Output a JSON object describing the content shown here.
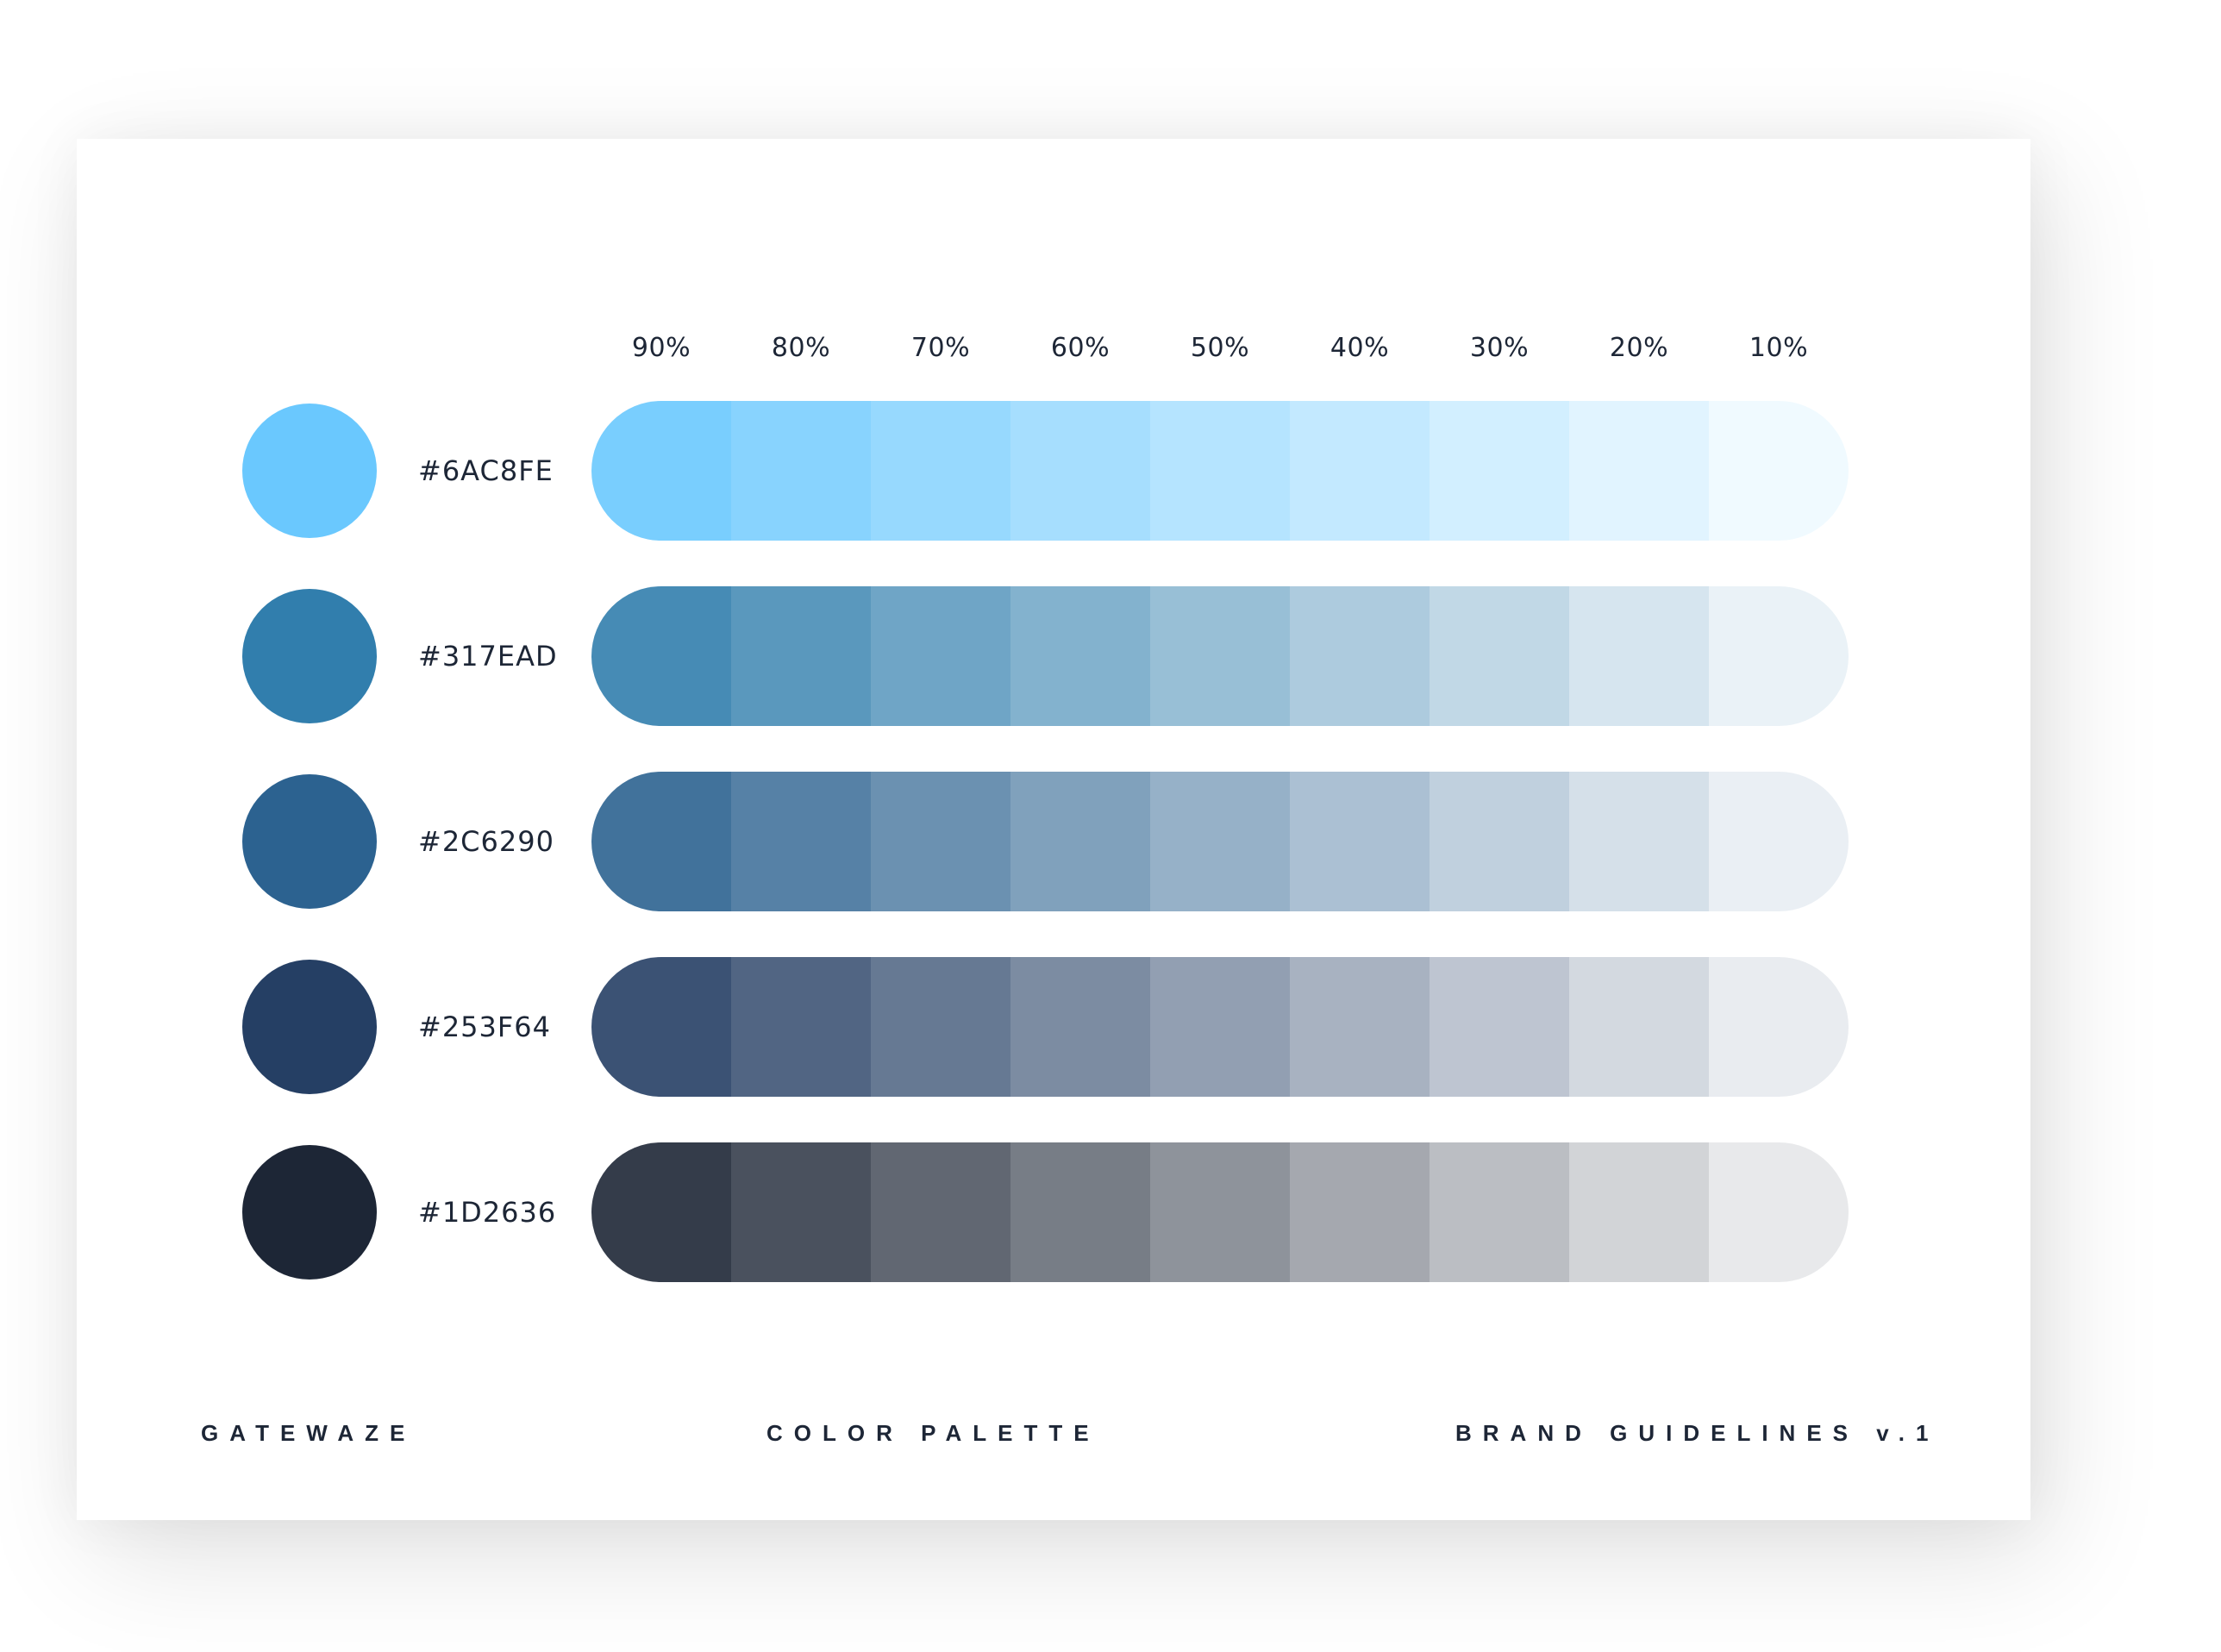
{
  "percent_labels": [
    "90%",
    "80%",
    "70%",
    "60%",
    "50%",
    "40%",
    "30%",
    "20%",
    "10%"
  ],
  "tint_levels": [
    0.9,
    0.8,
    0.7,
    0.6,
    0.5,
    0.4,
    0.3,
    0.2,
    0.1
  ],
  "swatches": [
    {
      "hex": "#6AC8FE"
    },
    {
      "hex": "#317EAD"
    },
    {
      "hex": "#2C6290"
    },
    {
      "hex": "#253F64"
    },
    {
      "hex": "#1D2636"
    }
  ],
  "footer": {
    "brand": "GATEWAZE",
    "section": "COLOR PALETTE",
    "doc": "BRAND GUIDELINES v.1"
  }
}
